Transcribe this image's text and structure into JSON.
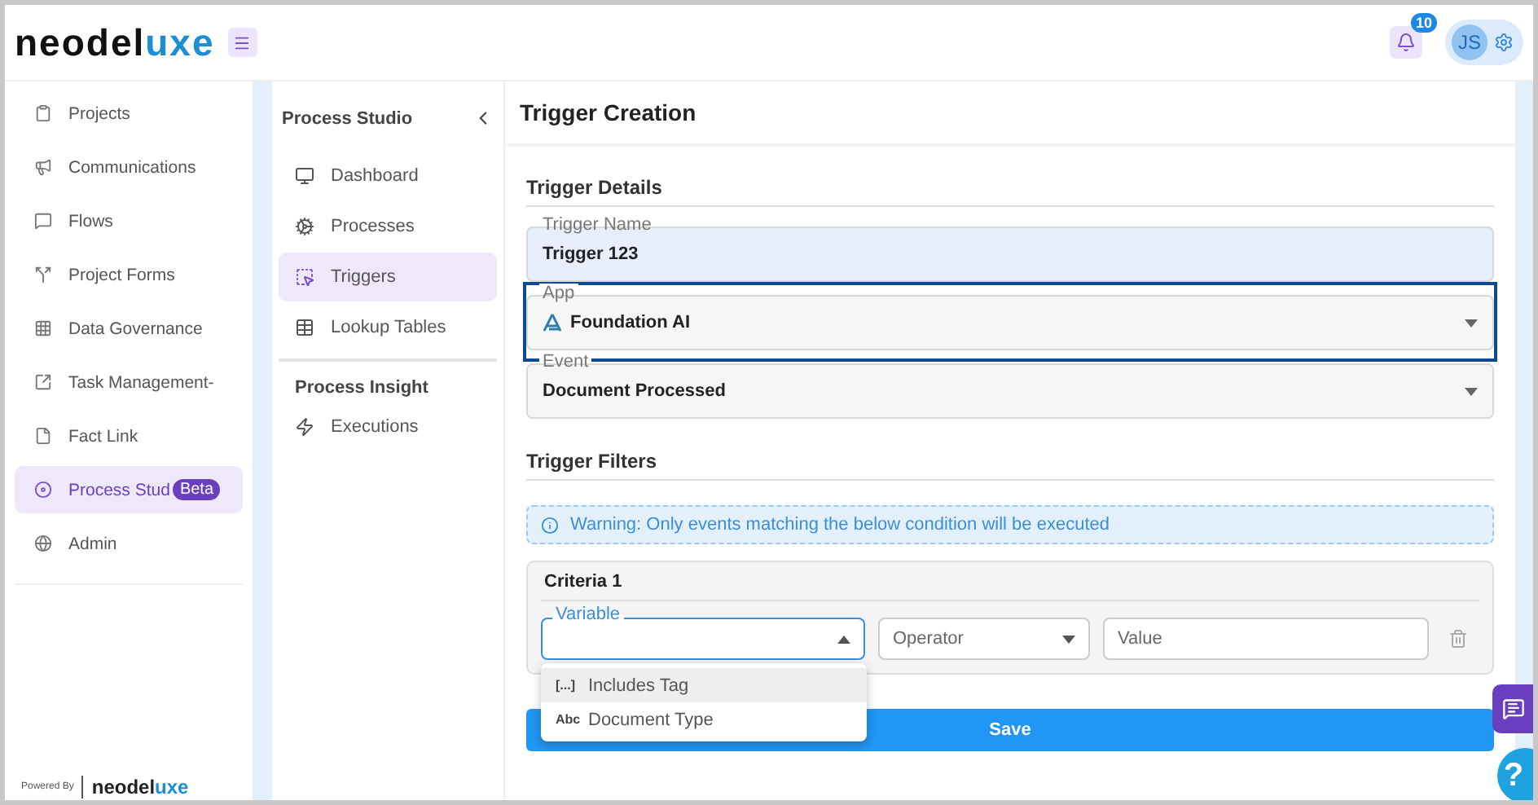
{
  "brand": {
    "logo_dark": "neodel",
    "logo_accent": "uxe"
  },
  "header": {
    "notification_count": "10",
    "avatar": "JS"
  },
  "sidebar": {
    "items": [
      {
        "label": "Projects",
        "selected": false
      },
      {
        "label": "Communications",
        "selected": false
      },
      {
        "label": "Flows",
        "selected": false
      },
      {
        "label": "Project Forms",
        "selected": false
      },
      {
        "label": "Data Governance",
        "selected": false
      },
      {
        "label": "Task Management-",
        "selected": false
      },
      {
        "label": "Fact Link",
        "selected": false
      },
      {
        "label": "Process Stud",
        "selected": true,
        "badge": "Beta"
      },
      {
        "label": "Admin",
        "selected": false
      }
    ]
  },
  "footer": {
    "powered_by": "Powered By",
    "brand_dark": "neodel",
    "brand_accent": "uxe"
  },
  "subnav": {
    "title": "Process Studio",
    "sections": [
      {
        "items": [
          {
            "label": "Dashboard",
            "selected": false
          },
          {
            "label": "Processes",
            "selected": false
          },
          {
            "label": "Triggers",
            "selected": true
          },
          {
            "label": "Lookup Tables",
            "selected": false
          }
        ]
      },
      {
        "title": "Process Insight",
        "items": [
          {
            "label": "Executions",
            "selected": false
          }
        ]
      }
    ]
  },
  "page": {
    "title": "Trigger Creation",
    "details": {
      "title": "Trigger Details",
      "fields": [
        {
          "kind": "text",
          "label": "Trigger Name",
          "value": "Trigger 123",
          "highlighted": false
        },
        {
          "kind": "app-select",
          "label": "App",
          "value": "Foundation AI",
          "highlighted": true
        },
        {
          "kind": "select",
          "label": "Event",
          "value": "Document Processed",
          "highlighted": false
        }
      ]
    },
    "filters": {
      "title": "Trigger Filters",
      "warning": "Warning: Only events matching the below condition will be executed",
      "criteria": {
        "title": "Criteria 1",
        "variable": {
          "label": "Variable",
          "open": true
        },
        "operator": {
          "placeholder": "Operator"
        },
        "value": {
          "placeholder": "Value"
        },
        "options": [
          {
            "glyph": "[...]",
            "label": "Includes Tag",
            "selected": true
          },
          {
            "glyph": "Abc",
            "label": "Document Type",
            "selected": false
          }
        ]
      }
    },
    "save": "Save"
  },
  "help": {
    "label": "?"
  }
}
